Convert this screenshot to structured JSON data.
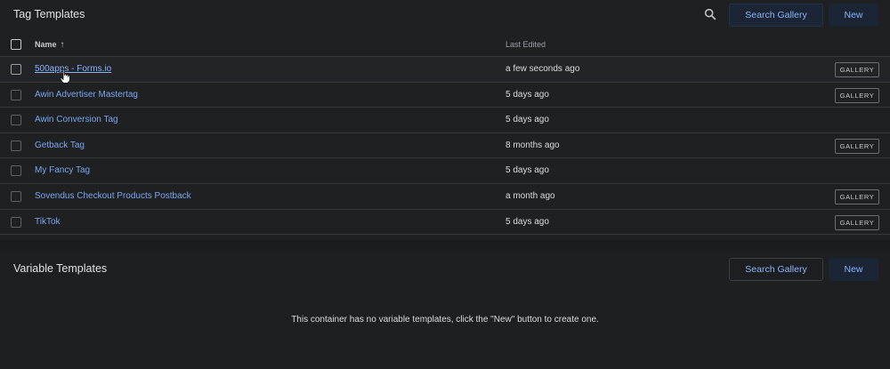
{
  "tag_templates": {
    "title": "Tag Templates",
    "search_gallery_label": "Search Gallery",
    "new_label": "New",
    "columns": {
      "name": "Name",
      "last_edited": "Last Edited"
    },
    "rows": [
      {
        "name": "500apps - Forms.io",
        "last_edited": "a few seconds ago",
        "badge": "GALLERY"
      },
      {
        "name": "Awin Advertiser Mastertag",
        "last_edited": "5 days ago",
        "badge": "GALLERY"
      },
      {
        "name": "Awin Conversion Tag",
        "last_edited": "5 days ago",
        "badge": ""
      },
      {
        "name": "Getback Tag",
        "last_edited": "8 months ago",
        "badge": "GALLERY"
      },
      {
        "name": "My Fancy Tag",
        "last_edited": "5 days ago",
        "badge": ""
      },
      {
        "name": "Sovendus Checkout Products Postback",
        "last_edited": "a month ago",
        "badge": "GALLERY"
      },
      {
        "name": "TikTok",
        "last_edited": "5 days ago",
        "badge": "GALLERY"
      }
    ]
  },
  "variable_templates": {
    "title": "Variable Templates",
    "search_gallery_label": "Search Gallery",
    "new_label": "New",
    "empty_message": "This container has no variable templates, click the \"New\" button to create one."
  },
  "icons": {
    "search": "search-icon",
    "sort": "arrow-up-icon",
    "cursor": "hand-pointer-icon"
  },
  "colors": {
    "background": "#1b1c1e",
    "link": "#8ab4f8",
    "accent_button_bg": "#1b2536"
  }
}
